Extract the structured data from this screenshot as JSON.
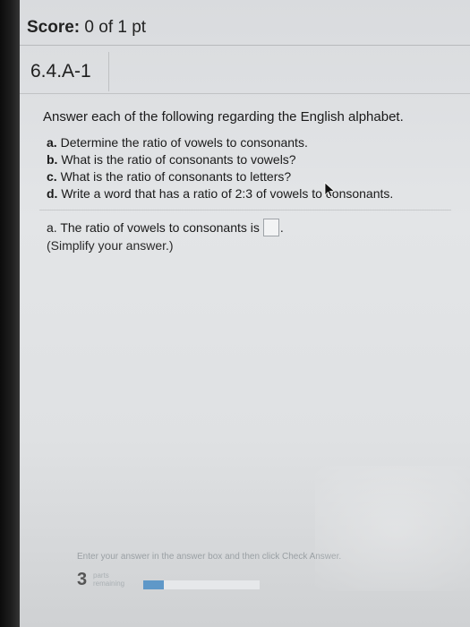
{
  "header": {
    "score_label": "Score:",
    "score_value": "0 of 1 pt"
  },
  "question_tab": {
    "label": "6.4.A-1"
  },
  "question": {
    "intro": "Answer each of the following regarding the English alphabet.",
    "parts": [
      {
        "letter": "a.",
        "text": "Determine the ratio of vowels to consonants."
      },
      {
        "letter": "b.",
        "text": "What is the ratio of consonants to vowels?"
      },
      {
        "letter": "c.",
        "text": "What is the ratio of consonants to letters?"
      },
      {
        "letter": "d.",
        "text": "Write a word that has a ratio of 2:3 of vowels to consonants."
      }
    ]
  },
  "answer": {
    "prompt": "a. The ratio of vowels to consonants is",
    "value": "",
    "period": ".",
    "hint": "(Simplify your answer.)"
  },
  "footer": {
    "instruction": "Enter your answer in the answer box and then click Check Answer.",
    "parts_count": "3",
    "parts_label_1": "parts",
    "parts_label_2": "remaining",
    "progress_fraction": 0.18
  }
}
